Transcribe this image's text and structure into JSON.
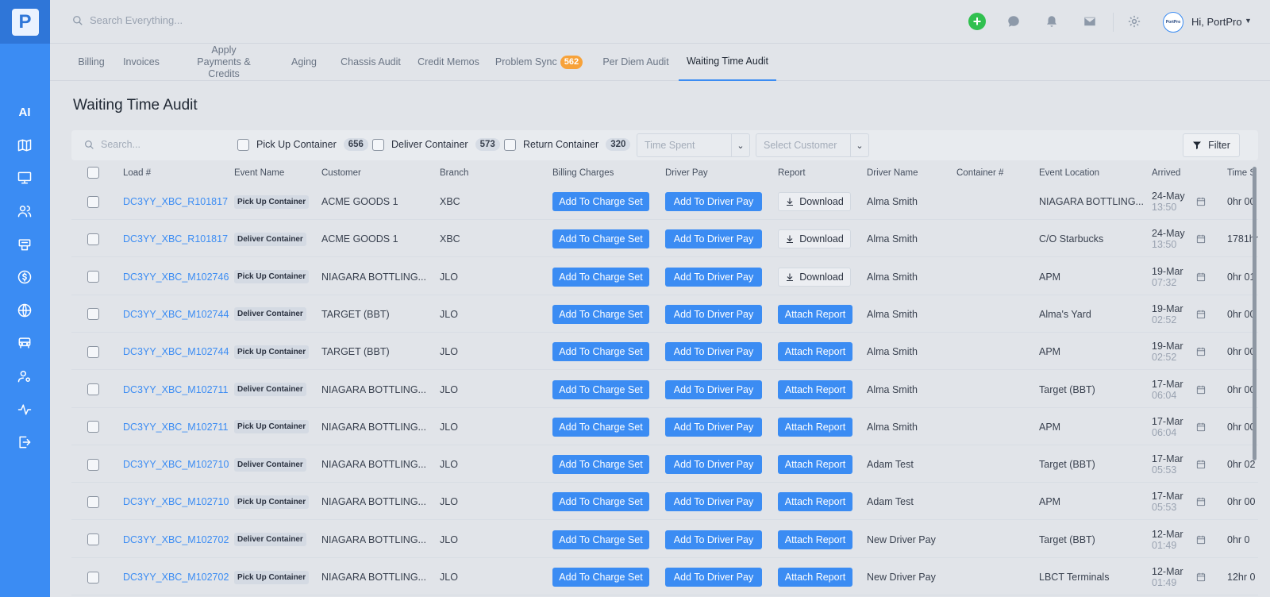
{
  "app": {
    "logo_letter": "P",
    "brand": "PortPro"
  },
  "sidebar": {
    "items": [
      {
        "name": "ai",
        "label": "AI"
      },
      {
        "name": "map"
      },
      {
        "name": "monitor"
      },
      {
        "name": "users"
      },
      {
        "name": "printer"
      },
      {
        "name": "billing"
      },
      {
        "name": "globe"
      },
      {
        "name": "truck"
      },
      {
        "name": "user-settings"
      },
      {
        "name": "activity"
      },
      {
        "name": "logout"
      }
    ]
  },
  "header": {
    "search_placeholder": "Search Everything...",
    "greeting": "Hi, PortPro"
  },
  "tabs": [
    {
      "label": "Billing"
    },
    {
      "label": "Invoices"
    },
    {
      "label": "Apply\nPayments & Credits"
    },
    {
      "label": "Aging"
    },
    {
      "label": "Chassis Audit"
    },
    {
      "label": "Credit Memos"
    },
    {
      "label": "Problem Sync",
      "badge": "562"
    },
    {
      "label": "Per Diem Audit"
    },
    {
      "label": "Waiting Time Audit",
      "active": true
    }
  ],
  "page_title": "Waiting Time Audit",
  "filters": {
    "search_placeholder": "Search...",
    "checks": [
      {
        "label": "Pick Up Container",
        "count": "656"
      },
      {
        "label": "Deliver Container",
        "count": "573"
      },
      {
        "label": "Return Container",
        "count": "320"
      }
    ],
    "time_spent_placeholder": "Time Spent",
    "customer_placeholder": "Select Customer",
    "filter_label": "Filter"
  },
  "table": {
    "columns": [
      "Load #",
      "Event Name",
      "Customer",
      "Branch",
      "Billing Charges",
      "Driver Pay",
      "Report",
      "Driver Name",
      "Container #",
      "Event Location",
      "Arrived",
      "Time S"
    ],
    "charge_label": "Add To Charge Set",
    "pay_label": "Add To Driver Pay",
    "rows": [
      {
        "load": "DC3YY_XBC_R101817",
        "event": "Pick Up Container",
        "customer": "ACME GOODS 1",
        "branch": "XBC",
        "report": "Download",
        "driver": "Alma Smith",
        "container": "",
        "location": "NIAGARA BOTTLING...",
        "date": "24-May",
        "time": "13:50",
        "spent": "0hr 00"
      },
      {
        "load": "DC3YY_XBC_R101817",
        "event": "Deliver Container",
        "customer": "ACME GOODS 1",
        "branch": "XBC",
        "report": "Download",
        "driver": "Alma Smith",
        "container": "",
        "location": "C/O Starbucks",
        "date": "24-May",
        "time": "13:50",
        "spent": "1781hr"
      },
      {
        "load": "DC3YY_XBC_M102746",
        "event": "Pick Up Container",
        "customer": "NIAGARA BOTTLING...",
        "branch": "JLO",
        "report": "Download",
        "driver": "Alma Smith",
        "container": "",
        "location": "APM",
        "date": "19-Mar",
        "time": "07:32",
        "spent": "0hr 01"
      },
      {
        "load": "DC3YY_XBC_M102744",
        "event": "Deliver Container",
        "customer": "TARGET (BBT)",
        "branch": "JLO",
        "report": "Attach Report",
        "driver": "Alma Smith",
        "container": "",
        "location": "Alma's Yard",
        "date": "19-Mar",
        "time": "02:52",
        "spent": "0hr 00"
      },
      {
        "load": "DC3YY_XBC_M102744",
        "event": "Pick Up Container",
        "customer": "TARGET (BBT)",
        "branch": "JLO",
        "report": "Attach Report",
        "driver": "Alma Smith",
        "container": "",
        "location": "APM",
        "date": "19-Mar",
        "time": "02:52",
        "spent": "0hr 00"
      },
      {
        "load": "DC3YY_XBC_M102711",
        "event": "Deliver Container",
        "customer": "NIAGARA BOTTLING...",
        "branch": "JLO",
        "report": "Attach Report",
        "driver": "Alma Smith",
        "container": "",
        "location": "Target (BBT)",
        "date": "17-Mar",
        "time": "06:04",
        "spent": "0hr 00"
      },
      {
        "load": "DC3YY_XBC_M102711",
        "event": "Pick Up Container",
        "customer": "NIAGARA BOTTLING...",
        "branch": "JLO",
        "report": "Attach Report",
        "driver": "Alma Smith",
        "container": "",
        "location": "APM",
        "date": "17-Mar",
        "time": "06:04",
        "spent": "0hr 00"
      },
      {
        "load": "DC3YY_XBC_M102710",
        "event": "Deliver Container",
        "customer": "NIAGARA BOTTLING...",
        "branch": "JLO",
        "report": "Attach Report",
        "driver": "Adam Test",
        "container": "",
        "location": "Target (BBT)",
        "date": "17-Mar",
        "time": "05:53",
        "spent": "0hr 02"
      },
      {
        "load": "DC3YY_XBC_M102710",
        "event": "Pick Up Container",
        "customer": "NIAGARA BOTTLING...",
        "branch": "JLO",
        "report": "Attach Report",
        "driver": "Adam Test",
        "container": "",
        "location": "APM",
        "date": "17-Mar",
        "time": "05:53",
        "spent": "0hr 00"
      },
      {
        "load": "DC3YY_XBC_M102702",
        "event": "Deliver Container",
        "customer": "NIAGARA BOTTLING...",
        "branch": "JLO",
        "report": "Attach Report",
        "driver": "New Driver Pay",
        "container": "",
        "location": "Target (BBT)",
        "date": "12-Mar",
        "time": "01:49",
        "spent": "0hr 0"
      },
      {
        "load": "DC3YY_XBC_M102702",
        "event": "Pick Up Container",
        "customer": "NIAGARA BOTTLING...",
        "branch": "JLO",
        "report": "Attach Report",
        "driver": "New Driver Pay",
        "container": "",
        "location": "LBCT Terminals",
        "date": "12-Mar",
        "time": "01:49",
        "spent": "12hr 0"
      }
    ]
  }
}
